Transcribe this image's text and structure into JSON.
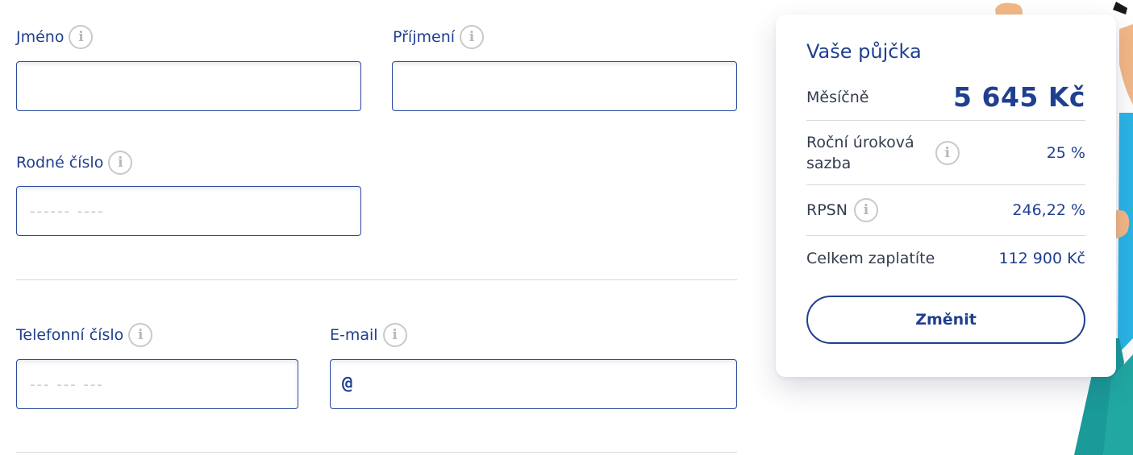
{
  "form": {
    "first_name": {
      "label": "Jméno",
      "value": "",
      "placeholder": ""
    },
    "last_name": {
      "label": "Příjmení",
      "value": "",
      "placeholder": ""
    },
    "birth_number": {
      "label": "Rodné číslo",
      "value": "",
      "placeholder": "------ ----"
    },
    "phone": {
      "label": "Telefonní číslo",
      "value": "",
      "placeholder": "--- --- ---"
    },
    "email": {
      "label": "E-mail",
      "value": "",
      "placeholder": "",
      "prefix": "@"
    }
  },
  "icons": {
    "info": "info-icon",
    "info_glyph": "i"
  },
  "summary": {
    "title": "Vaše půjčka",
    "monthly": {
      "label": "Měsíčně",
      "value": "5 645 Kč"
    },
    "rate": {
      "label_line1": "Roční úroková",
      "label_line2": "sazba",
      "value": "25 %"
    },
    "rpsn": {
      "label": "RPSN",
      "value": "246,22 %"
    },
    "total": {
      "label": "Celkem zaplatíte",
      "value": "112 900 Kč"
    },
    "change_label": "Změnit"
  },
  "colors": {
    "brand_blue": "#1f3f8f",
    "border": "#2a4a9a",
    "divider": "#d8d8d8",
    "mascot_blue": "#2bb5e6",
    "mascot_teal": "#1b9a9a",
    "mascot_skin": "#f3b886"
  }
}
